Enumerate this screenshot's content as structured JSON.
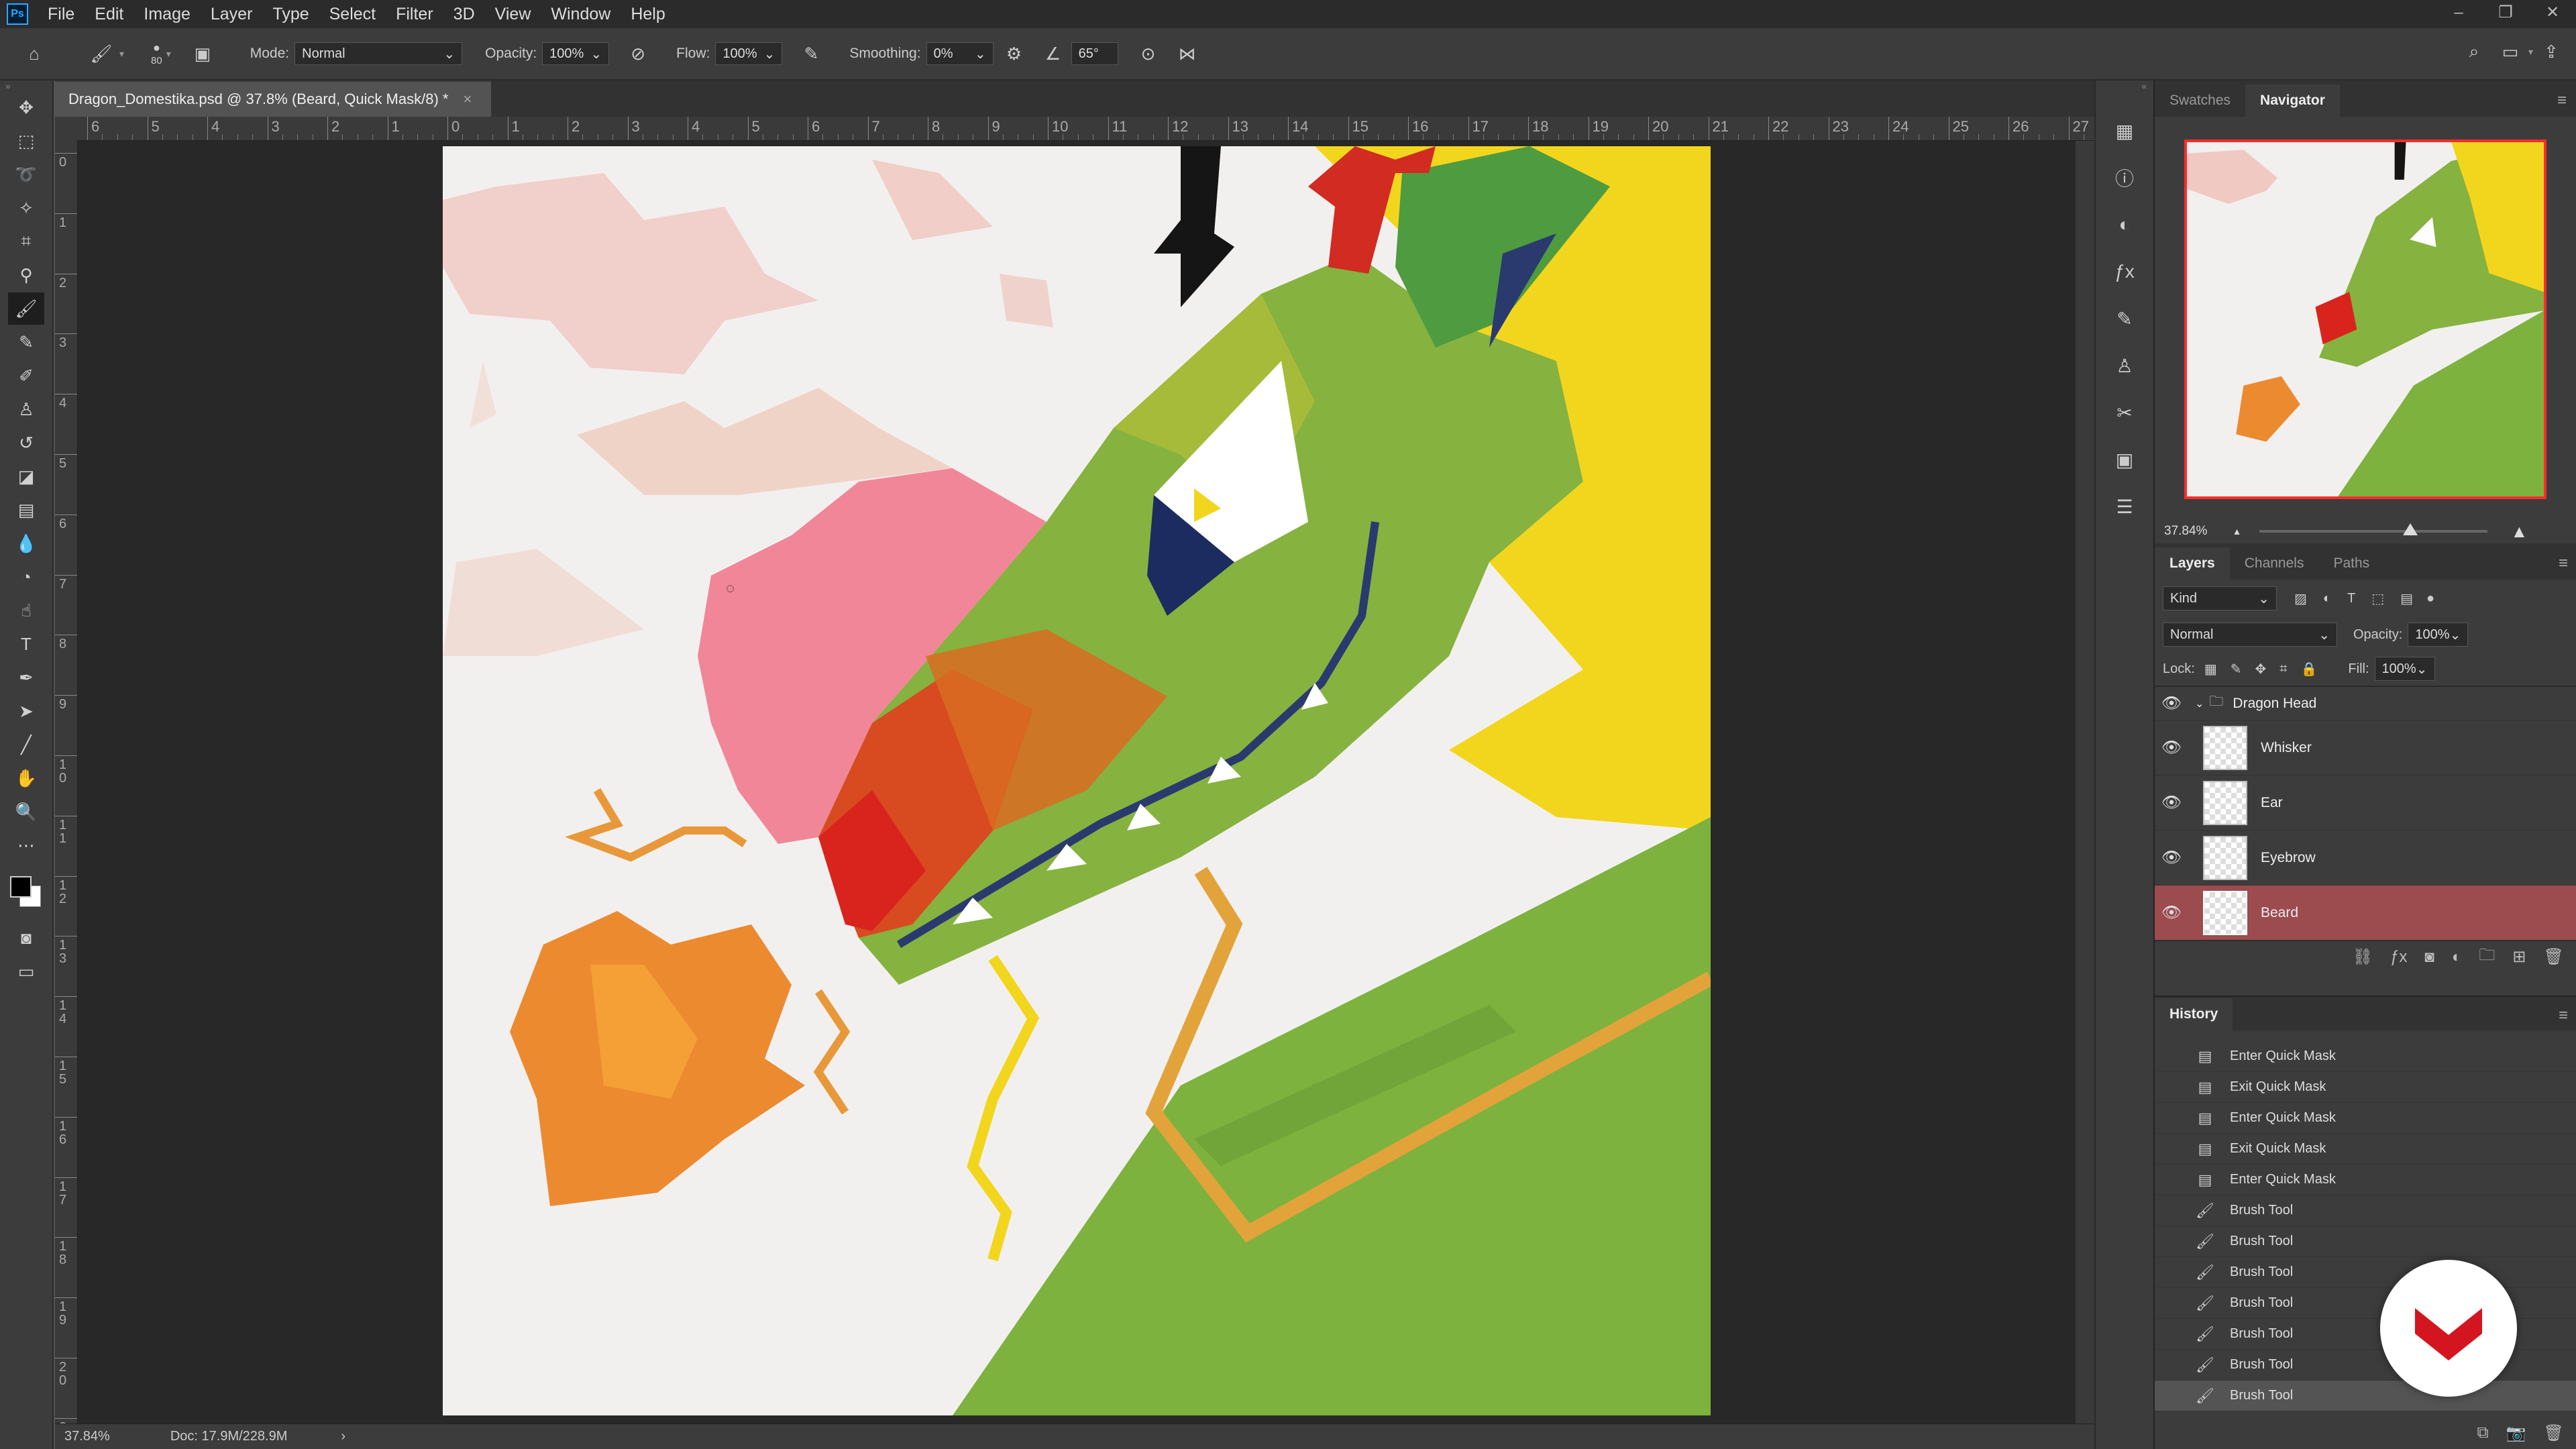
{
  "app": {
    "logo": "Ps"
  },
  "menubar": {
    "items": [
      "File",
      "Edit",
      "Image",
      "Layer",
      "Type",
      "Select",
      "Filter",
      "3D",
      "View",
      "Window",
      "Help"
    ],
    "window_buttons": {
      "minimize": "–",
      "restore": "❐",
      "close": "✕"
    }
  },
  "options": {
    "brush_size": "80",
    "mode_label": "Mode:",
    "mode_value": "Normal",
    "opacity_label": "Opacity:",
    "opacity_value": "100%",
    "flow_label": "Flow:",
    "flow_value": "100%",
    "smoothing_label": "Smoothing:",
    "smoothing_value": "0%",
    "angle_value": "65°"
  },
  "document": {
    "tab_title": "Dragon_Domestika.psd @ 37.8% (Beard, Quick Mask/8) *",
    "close": "×"
  },
  "rulers": {
    "h_labels": [
      "6",
      "5",
      "4",
      "3",
      "2",
      "1",
      "0",
      "1",
      "2",
      "3",
      "4",
      "5",
      "6",
      "7",
      "8",
      "9",
      "10",
      "11",
      "12",
      "13",
      "14",
      "15",
      "16",
      "17",
      "18",
      "19",
      "20",
      "21",
      "22",
      "23",
      "24",
      "25",
      "26",
      "27"
    ],
    "v_labels": [
      "0",
      "1",
      "2",
      "3",
      "4",
      "5",
      "6",
      "7",
      "8",
      "9",
      "10",
      "11",
      "12",
      "13",
      "14",
      "15",
      "16",
      "17",
      "18",
      "19",
      "20",
      "2"
    ]
  },
  "status": {
    "zoom": "37.84%",
    "doc": "Doc: 17.9M/228.9M",
    "arrow": "›"
  },
  "navigator": {
    "tabs": [
      "Swatches",
      "Navigator"
    ],
    "active_tab": "Navigator",
    "zoom": "37.84%",
    "zoom_slider": 0.66
  },
  "layers": {
    "tabs": [
      "Layers",
      "Channels",
      "Paths"
    ],
    "filter_kind": "Kind",
    "blend_mode": "Normal",
    "opacity_label": "Opacity:",
    "opacity_value": "100%",
    "lock_label": "Lock:",
    "fill_label": "Fill:",
    "fill_value": "100%",
    "group_name": "Dragon Head",
    "items": [
      "Whisker",
      "Ear",
      "Eyebrow",
      "Beard"
    ],
    "selected": "Beard",
    "selected_color": "#9c4b4f"
  },
  "history": {
    "title": "History",
    "items": [
      "Enter Quick Mask",
      "Exit Quick Mask",
      "Enter Quick Mask",
      "Exit Quick Mask",
      "Enter Quick Mask",
      "Brush Tool",
      "Brush Tool",
      "Brush Tool",
      "Brush Tool",
      "Brush Tool",
      "Brush Tool",
      "Brush Tool"
    ],
    "current_index": 11
  },
  "colors": {
    "accent_red": "#d2151f",
    "selection_border": "#ff2b2b"
  },
  "icons": {
    "tools": [
      "move",
      "marquee",
      "lasso",
      "magic-wand",
      "crop",
      "eyedropper",
      "brush",
      "pencil",
      "mixer-brush",
      "clone-stamp",
      "history-brush",
      "eraser",
      "gradient",
      "blur",
      "dodge",
      "smudge",
      "type",
      "pen",
      "path-select",
      "line",
      "hand",
      "zoom",
      "more"
    ]
  }
}
